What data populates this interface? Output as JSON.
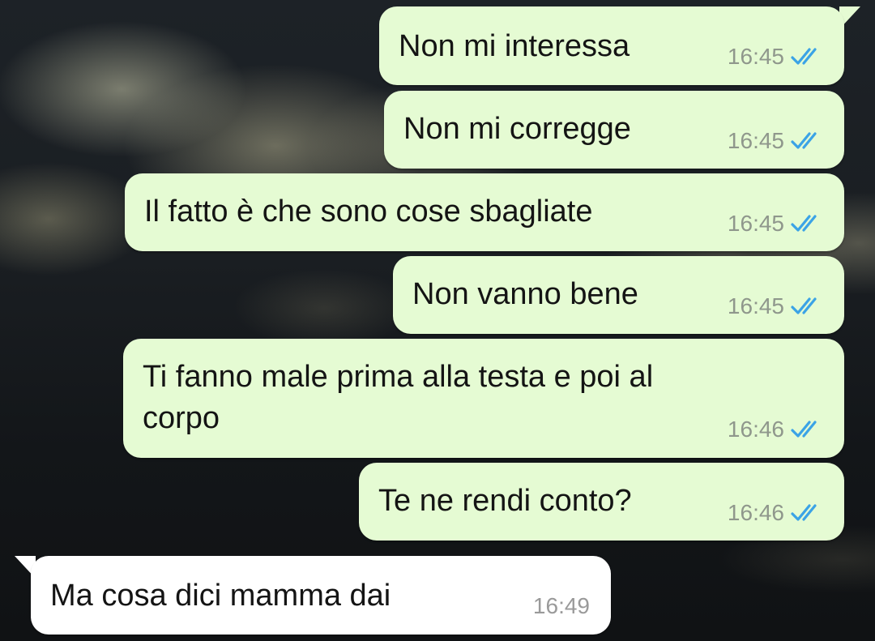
{
  "chat": {
    "messages": [
      {
        "direction": "outgoing",
        "text": "Non mi interessa",
        "time": "16:45",
        "status": "read"
      },
      {
        "direction": "outgoing",
        "text": "Non mi corregge",
        "time": "16:45",
        "status": "read"
      },
      {
        "direction": "outgoing",
        "text": "Il fatto è che sono cose sbagliate",
        "time": "16:45",
        "status": "read"
      },
      {
        "direction": "outgoing",
        "text": "Non vanno bene",
        "time": "16:45",
        "status": "read"
      },
      {
        "direction": "outgoing",
        "text_line1": "Ti fanno male prima alla testa e poi al",
        "text_line2": "corpo",
        "time": "16:46",
        "status": "read"
      },
      {
        "direction": "outgoing",
        "text": "Te ne rendi conto?",
        "time": "16:46",
        "status": "read"
      },
      {
        "direction": "incoming",
        "text": "Ma cosa dici mamma dai",
        "time": "16:49"
      }
    ]
  },
  "colors": {
    "outgoing_bubble": "#e5fbd3",
    "incoming_bubble": "#ffffff",
    "read_tick": "#3ba3e6"
  },
  "icons": {
    "read_receipt": "double-check-icon"
  }
}
